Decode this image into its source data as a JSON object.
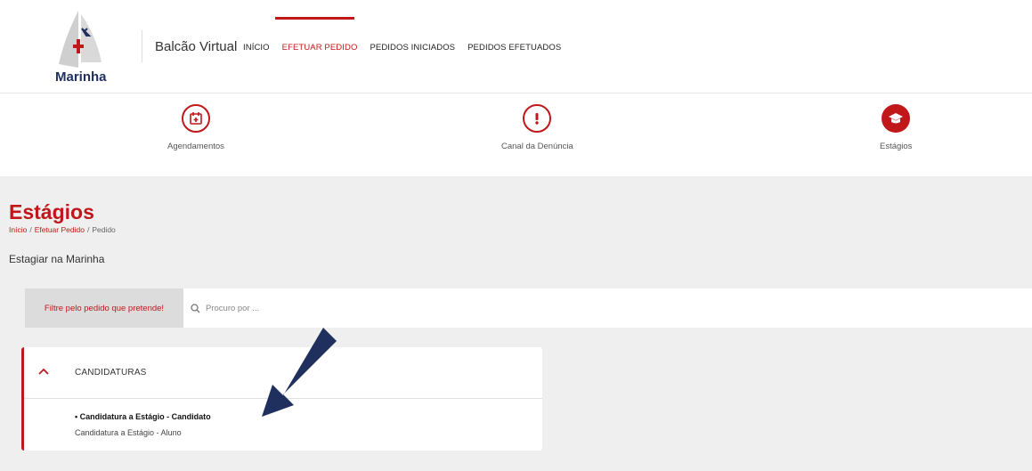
{
  "header": {
    "logo_text": "Marinha",
    "brand": "Balcão Virtual",
    "nav": [
      {
        "label": "INÍCIO",
        "active": false
      },
      {
        "label": "EFETUAR PEDIDO",
        "active": true
      },
      {
        "label": "PEDIDOS INICIADOS",
        "active": false
      },
      {
        "label": "PEDIDOS EFETUADOS",
        "active": false
      }
    ]
  },
  "services": [
    {
      "label": "Agendamentos",
      "icon": "calendar-icon"
    },
    {
      "label": "Canal da Denúncia",
      "icon": "exclamation-icon"
    },
    {
      "label": "Estágios",
      "icon": "graduation-cap-icon"
    }
  ],
  "page": {
    "title": "Estágios",
    "breadcrumb": [
      "Início",
      "Efetuar Pedido",
      "Pedido"
    ],
    "subtitle": "Estagiar na Marinha"
  },
  "filter": {
    "label": "Filtre pelo pedido que pretende!",
    "placeholder": "Procuro por ..."
  },
  "category": {
    "title": "CANDIDATURAS",
    "items": [
      {
        "title": "• Candidatura a Estágio - Candidato",
        "subtitle": "Candidatura a Estágio - Aluno"
      }
    ]
  },
  "colors": {
    "accent": "#c0171b",
    "arrow": "#1f2f5e",
    "background": "#efefef"
  }
}
